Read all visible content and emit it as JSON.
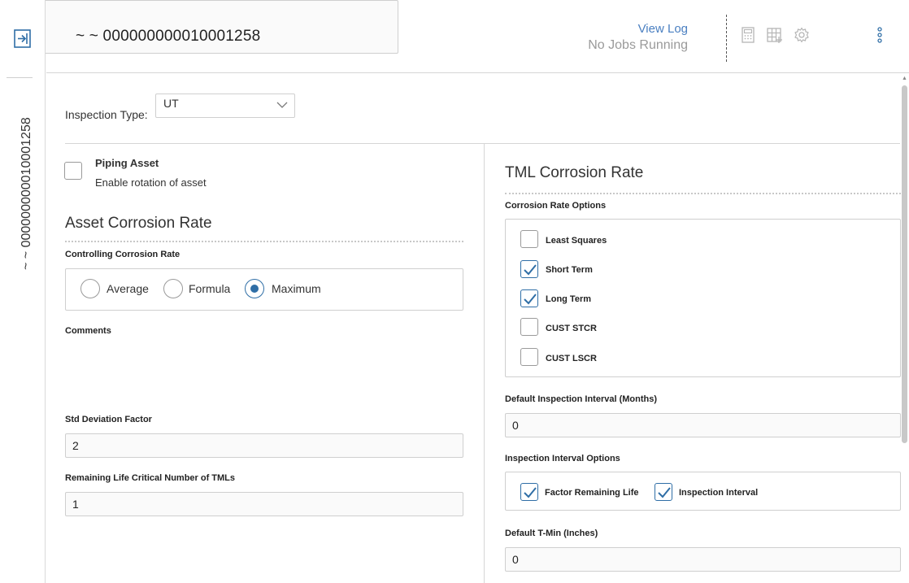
{
  "header": {
    "title": "~ ~ 000000000010001258",
    "view_log": "View Log",
    "jobs_status": "No Jobs Running"
  },
  "rail": {
    "label": "~ ~ 000000000010001258"
  },
  "inspection_type": {
    "label": "Inspection Type:",
    "value": "UT"
  },
  "piping_asset": {
    "title": "Piping Asset",
    "description": "Enable rotation of asset",
    "checked": false
  },
  "asset_corrosion_rate": {
    "title": "Asset Corrosion Rate",
    "controlling_label": "Controlling Corrosion Rate",
    "options": [
      "Average",
      "Formula",
      "Maximum"
    ],
    "selected": "Maximum",
    "comments_label": "Comments",
    "comments_value": "",
    "std_dev_label": "Std Deviation Factor",
    "std_dev_value": "2",
    "rem_life_label": "Remaining Life Critical Number of TMLs",
    "rem_life_value": "1"
  },
  "tml_corrosion_rate": {
    "title": "TML Corrosion Rate",
    "options_label": "Corrosion Rate Options",
    "options": [
      {
        "label": "Least Squares",
        "checked": false
      },
      {
        "label": "Short Term",
        "checked": true
      },
      {
        "label": "Long Term",
        "checked": true
      },
      {
        "label": "CUST STCR",
        "checked": false
      },
      {
        "label": "CUST LSCR",
        "checked": false
      }
    ],
    "default_interval_label": "Default Inspection Interval (Months)",
    "default_interval_value": "0",
    "interval_options_label": "Inspection Interval Options",
    "interval_options": [
      {
        "label": "Factor Remaining Life",
        "checked": true
      },
      {
        "label": "Inspection Interval",
        "checked": true
      }
    ],
    "default_tmin_label": "Default T-Min (Inches)",
    "default_tmin_value": "0"
  },
  "colors": {
    "accent": "#2f6ea6",
    "link": "#4a7fc1",
    "muted": "#9a9a9a",
    "border": "#cfcfcf"
  },
  "icons": [
    "expand-panel-icon",
    "calculator-icon",
    "add-grid-icon",
    "gear-icon",
    "more-options-icon",
    "chevron-down-icon",
    "checkmark-icon"
  ]
}
